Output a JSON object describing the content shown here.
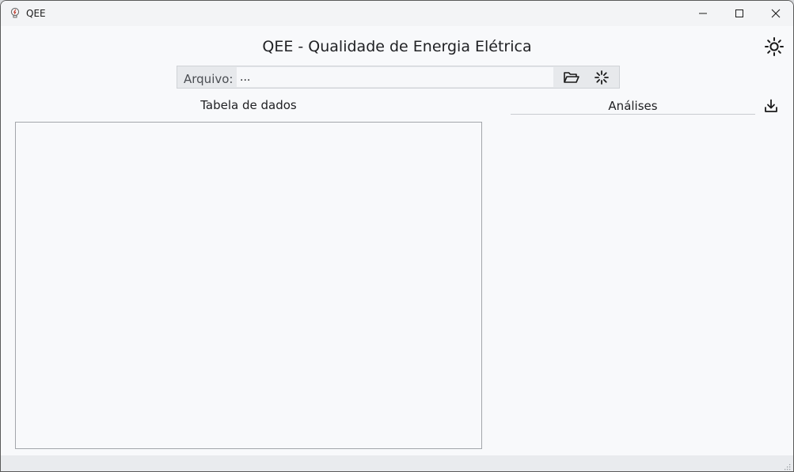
{
  "window": {
    "title": "QEE",
    "controls": {
      "minimize": "minimize-icon",
      "maximize": "maximize-icon",
      "close": "close-icon"
    }
  },
  "header": {
    "title": "QEE - Qualidade de Energia Elétrica",
    "theme_icon": "sun-icon"
  },
  "file": {
    "label": "Arquivo:",
    "value": "...",
    "open_icon": "folder-open-icon",
    "load_icon": "loading-spinner-icon"
  },
  "table_panel": {
    "title": "Tabela de dados"
  },
  "analysis_panel": {
    "title": "Análises",
    "download_icon": "download-icon"
  },
  "colors": {
    "background": "#f8f9fb",
    "titlebar": "#f3f4f6",
    "input_bar": "#e7e9ec"
  }
}
